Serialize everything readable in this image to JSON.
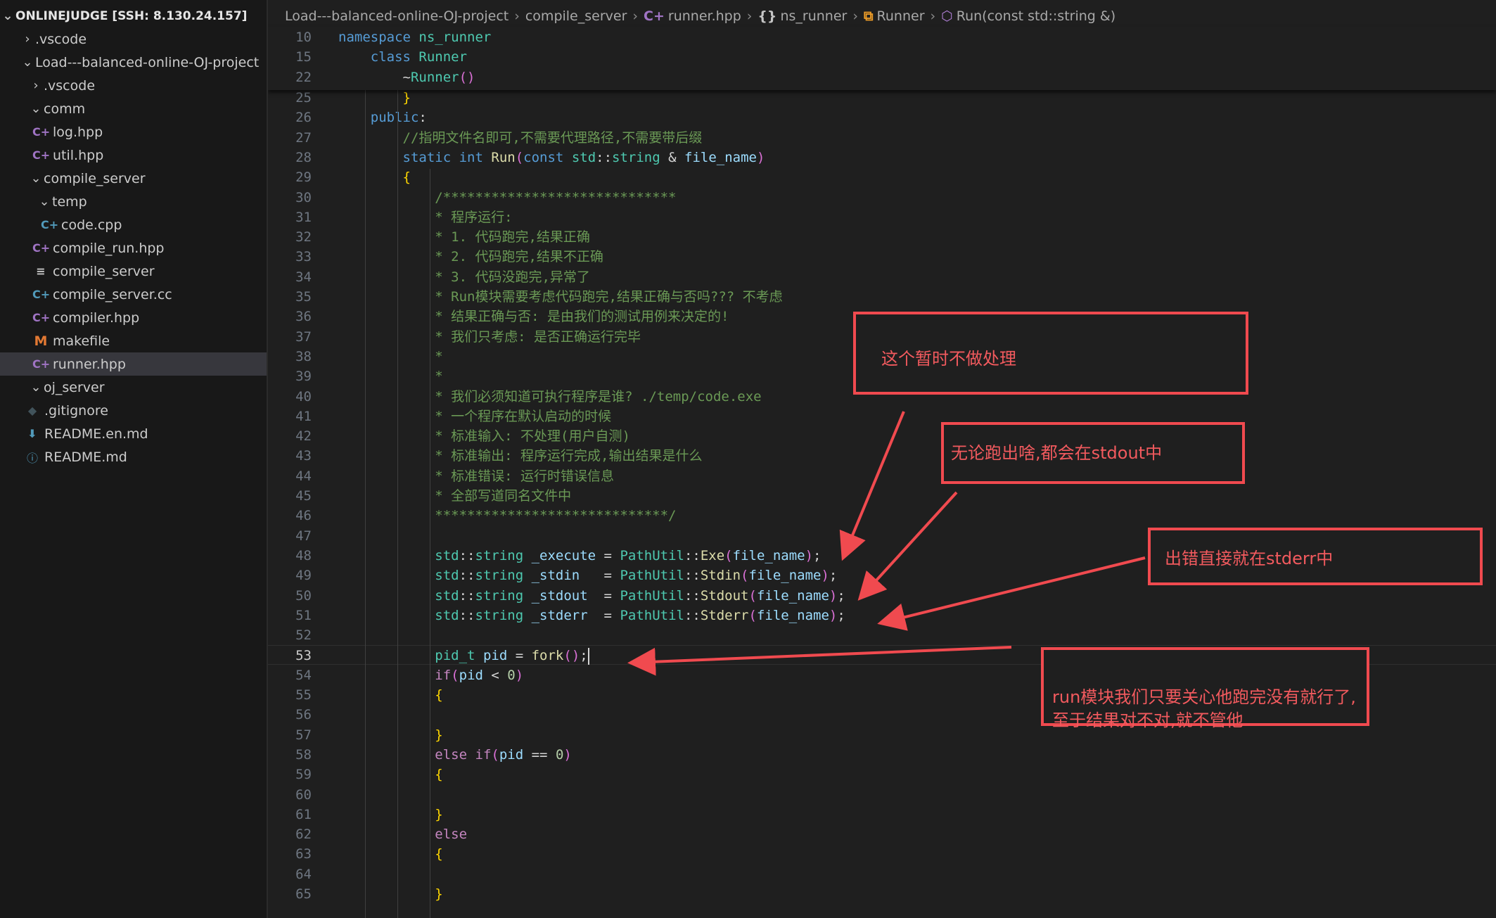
{
  "explorer": {
    "header": "ONLINEJUDGE [SSH: 8.130.24.157]",
    "items": [
      {
        "label": ".vscode",
        "kind": "folder",
        "open": false
      },
      {
        "label": "Load---balanced-online-OJ-project",
        "kind": "folder",
        "open": true
      },
      {
        "label": ".vscode",
        "kind": "folder",
        "open": false
      },
      {
        "label": "comm",
        "kind": "folder",
        "open": true
      },
      {
        "label": "log.hpp",
        "kind": "cpp",
        "icon": "C+"
      },
      {
        "label": "util.hpp",
        "kind": "cpp",
        "icon": "C+"
      },
      {
        "label": "compile_server",
        "kind": "folder",
        "open": true
      },
      {
        "label": "temp",
        "kind": "folder",
        "open": true
      },
      {
        "label": "code.cpp",
        "kind": "cc",
        "icon": "C+"
      },
      {
        "label": "compile_run.hpp",
        "kind": "cpp",
        "icon": "C+"
      },
      {
        "label": "compile_server",
        "kind": "txt",
        "icon": "≡"
      },
      {
        "label": "compile_server.cc",
        "kind": "cc",
        "icon": "C+"
      },
      {
        "label": "compiler.hpp",
        "kind": "cpp",
        "icon": "C+"
      },
      {
        "label": "makefile",
        "kind": "make",
        "icon": "M"
      },
      {
        "label": "runner.hpp",
        "kind": "cpp",
        "icon": "C+",
        "selected": true
      },
      {
        "label": "oj_server",
        "kind": "folder",
        "open": true
      },
      {
        "label": ".gitignore",
        "kind": "git",
        "icon": "◆"
      },
      {
        "label": "README.en.md",
        "kind": "md",
        "icon": "⬇"
      },
      {
        "label": "README.md",
        "kind": "info",
        "icon": "ⓘ"
      }
    ]
  },
  "breadcrumb": {
    "project": "Load---balanced-online-OJ-project",
    "folder": "compile_server",
    "file": "runner.hpp",
    "namespace": "ns_runner",
    "class": "Runner",
    "function": "Run(const std::string &)"
  },
  "sticky_lines": [
    {
      "n": "10",
      "code": "namespace ns_runner"
    },
    {
      "n": "15",
      "code": "    class Runner"
    },
    {
      "n": "22",
      "code": "        ~Runner()"
    }
  ],
  "code_lines": [
    {
      "n": "25",
      "code": "        }"
    },
    {
      "n": "26",
      "code": "    public:"
    },
    {
      "n": "27",
      "code": "        //指明文件名即可,不需要代理路径,不需要带后缀"
    },
    {
      "n": "28",
      "code": "        static int Run(const std::string & file_name)"
    },
    {
      "n": "29",
      "code": "        {"
    },
    {
      "n": "30",
      "code": "            /*****************************"
    },
    {
      "n": "31",
      "code": "            * 程序运行:"
    },
    {
      "n": "32",
      "code": "            * 1. 代码跑完,结果正确"
    },
    {
      "n": "33",
      "code": "            * 2. 代码跑完,结果不正确"
    },
    {
      "n": "34",
      "code": "            * 3. 代码没跑完,异常了"
    },
    {
      "n": "35",
      "code": "            * Run模块需要考虑代码跑完,结果正确与否吗??? 不考虑"
    },
    {
      "n": "36",
      "code": "            * 结果正确与否: 是由我们的测试用例来决定的!"
    },
    {
      "n": "37",
      "code": "            * 我们只考虑: 是否正确运行完毕"
    },
    {
      "n": "38",
      "code": "            *"
    },
    {
      "n": "39",
      "code": "            *"
    },
    {
      "n": "40",
      "code": "            * 我们必须知道可执行程序是谁? ./temp/code.exe"
    },
    {
      "n": "41",
      "code": "            * 一个程序在默认启动的时候"
    },
    {
      "n": "42",
      "code": "            * 标准输入: 不处理(用户自测)"
    },
    {
      "n": "43",
      "code": "            * 标准输出: 程序运行完成,输出结果是什么"
    },
    {
      "n": "44",
      "code": "            * 标准错误: 运行时错误信息"
    },
    {
      "n": "45",
      "code": "            * 全部写道同名文件中"
    },
    {
      "n": "46",
      "code": "            *****************************/"
    },
    {
      "n": "47",
      "code": ""
    },
    {
      "n": "48",
      "code": "            std::string _execute = PathUtil::Exe(file_name);"
    },
    {
      "n": "49",
      "code": "            std::string _stdin   = PathUtil::Stdin(file_name);"
    },
    {
      "n": "50",
      "code": "            std::string _stdout  = PathUtil::Stdout(file_name);"
    },
    {
      "n": "51",
      "code": "            std::string _stderr  = PathUtil::Stderr(file_name);"
    },
    {
      "n": "52",
      "code": ""
    },
    {
      "n": "53",
      "code": "            pid_t pid = fork();",
      "current": true
    },
    {
      "n": "54",
      "code": "            if(pid < 0)"
    },
    {
      "n": "55",
      "code": "            {"
    },
    {
      "n": "56",
      "code": ""
    },
    {
      "n": "57",
      "code": "            }"
    },
    {
      "n": "58",
      "code": "            else if(pid == 0)"
    },
    {
      "n": "59",
      "code": "            {"
    },
    {
      "n": "60",
      "code": ""
    },
    {
      "n": "61",
      "code": "            }"
    },
    {
      "n": "62",
      "code": "            else"
    },
    {
      "n": "63",
      "code": "            {"
    },
    {
      "n": "64",
      "code": ""
    },
    {
      "n": "65",
      "code": "            }"
    }
  ],
  "annotations": [
    {
      "id": "no-handle",
      "text": "这个暂时不做处理"
    },
    {
      "id": "stdout",
      "text": "无论跑出啥,都会在stdout中"
    },
    {
      "id": "stderr",
      "text": "出错直接就在stderr中"
    },
    {
      "id": "run-module",
      "text": "run模块我们只要关心他跑完没有就行了,\n至于结果对不对,就不管他"
    }
  ],
  "colors": {
    "keyword": "#569cd6",
    "comment": "#6a9955",
    "type": "#4ec9b0",
    "function": "#dcdcaa",
    "variable": "#9cdcfe",
    "number": "#b5cea8",
    "annotation": "#f04a4f"
  }
}
